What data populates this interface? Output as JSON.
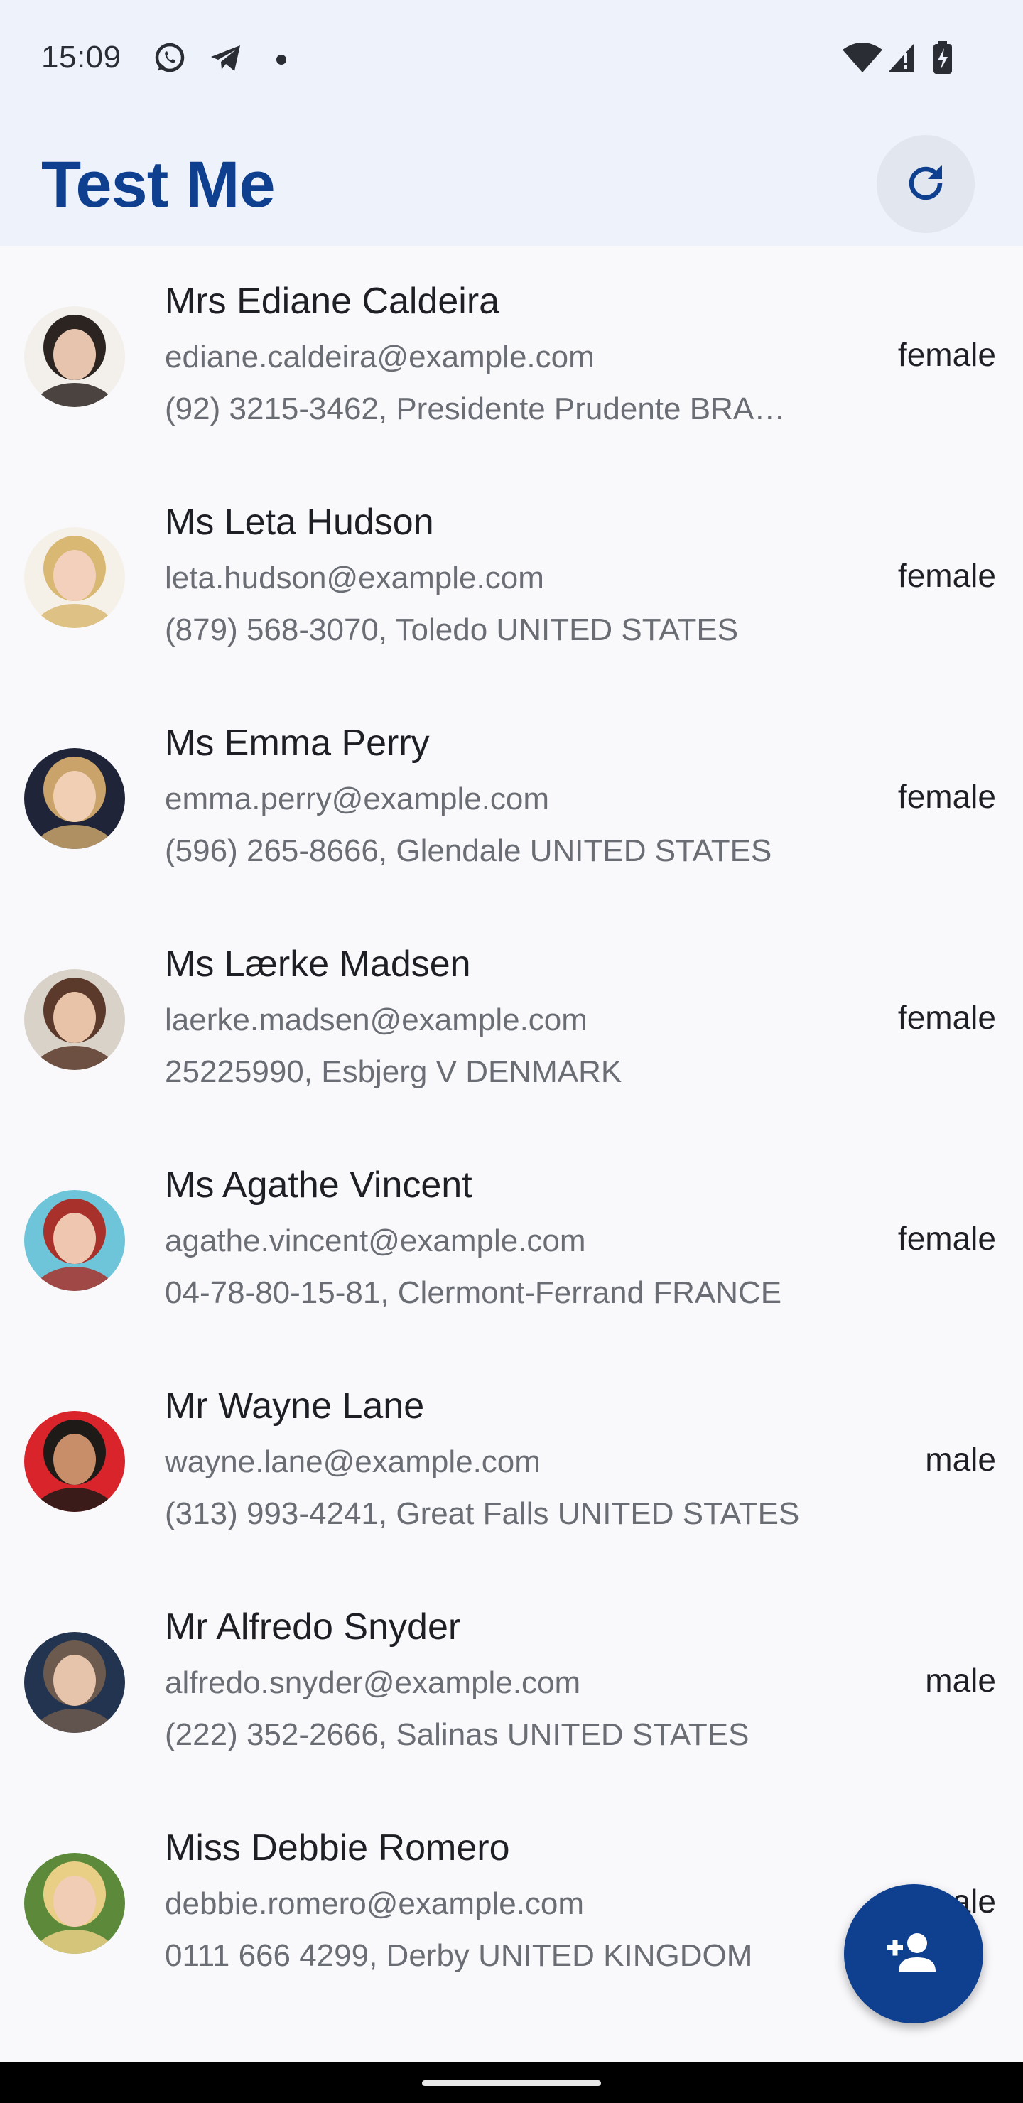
{
  "status_bar": {
    "time": "15:09",
    "left_icons": [
      "whatsapp-icon",
      "telegram-icon",
      "dot-icon"
    ],
    "right_icons": [
      "wifi-icon",
      "signal-icon",
      "battery-charging-icon"
    ]
  },
  "app_bar": {
    "title": "Test Me",
    "refresh_icon": "refresh-icon"
  },
  "users": [
    {
      "name": "Mrs Ediane Caldeira",
      "email": "ediane.caldeira@example.com",
      "address": "(92) 3215-3462, Presidente Prudente BRA…",
      "gender": "female",
      "avatar_colors": [
        "#2b2421",
        "#e7c4ae",
        "#f3f0ec"
      ]
    },
    {
      "name": "Ms Leta Hudson",
      "email": "leta.hudson@example.com",
      "address": "(879) 568-3070, Toledo UNITED STATES",
      "gender": "female",
      "avatar_colors": [
        "#d9b873",
        "#f2d0bb",
        "#f6f1e8"
      ]
    },
    {
      "name": "Ms Emma Perry",
      "email": "emma.perry@example.com",
      "address": "(596) 265-8666, Glendale UNITED STATES",
      "gender": "female",
      "avatar_colors": [
        "#c9a36a",
        "#f0cfb4",
        "#1f2438"
      ]
    },
    {
      "name": "Ms Lærke Madsen",
      "email": "laerke.madsen@example.com",
      "address": "25225990, Esbjerg V DENMARK",
      "gender": "female",
      "avatar_colors": [
        "#5b3a2c",
        "#e9c3a8",
        "#d9d2c8"
      ]
    },
    {
      "name": "Ms Agathe Vincent",
      "email": "agathe.vincent@example.com",
      "address": "04-78-80-15-81, Clermont-Ferrand FRANCE",
      "gender": "female",
      "avatar_colors": [
        "#a8322b",
        "#efc7b0",
        "#6ec4d8"
      ]
    },
    {
      "name": "Mr Wayne Lane",
      "email": "wayne.lane@example.com",
      "address": "(313) 993-4241, Great Falls UNITED STATES",
      "gender": "male",
      "avatar_colors": [
        "#1e1a18",
        "#c78e69",
        "#d8242a"
      ]
    },
    {
      "name": "Mr Alfredo Snyder",
      "email": "alfredo.snyder@example.com",
      "address": "(222) 352-2666, Salinas UNITED STATES",
      "gender": "male",
      "avatar_colors": [
        "#6c5a4e",
        "#e6c3ab",
        "#22344f"
      ]
    },
    {
      "name": "Miss Debbie Romero",
      "email": "debbie.romero@example.com",
      "address": "0111 666 4299, Derby UNITED KINGDOM",
      "gender": "female",
      "avatar_colors": [
        "#e9cf86",
        "#f1cdb6",
        "#5c8a3a"
      ]
    }
  ],
  "fab": {
    "icon": "add-person-icon"
  },
  "colors": {
    "primary": "#0f3f8f",
    "background": "#f9f9fc",
    "app_bar_bg": "#eef2fa"
  }
}
